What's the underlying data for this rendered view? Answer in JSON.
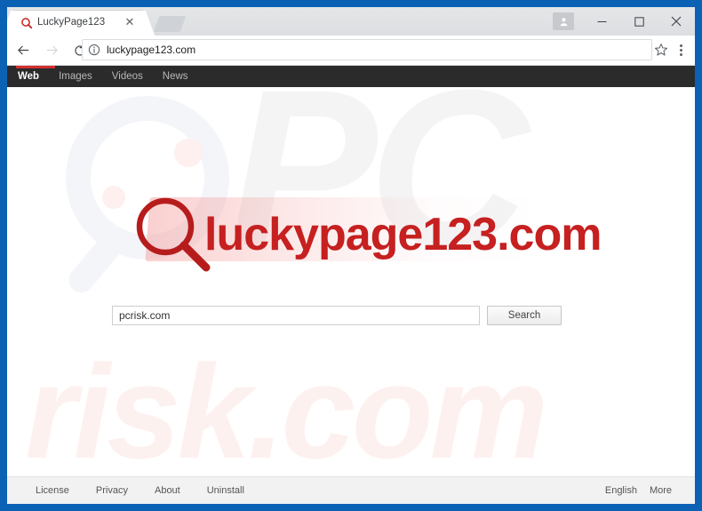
{
  "window": {
    "frame_color": "#0b62b5",
    "controls": {
      "profile_icon": "profile-icon",
      "minimize_label": "─",
      "maximize_label": "□",
      "close_label": "✕"
    }
  },
  "browser": {
    "tab": {
      "title": "LuckyPage123",
      "favicon": "magnifier-icon",
      "close_label": "✕"
    },
    "new_tab_label": "",
    "toolbar": {
      "back_icon": "back-arrow-icon",
      "forward_icon": "forward-arrow-icon",
      "reload_icon": "reload-icon",
      "site_info_icon": "info-circle-icon",
      "url": "luckypage123.com",
      "bookmark_icon": "star-icon",
      "menu_icon": "three-dot-menu-icon"
    }
  },
  "site": {
    "nav": {
      "accent_color": "#d32f2f",
      "items": [
        {
          "label": "Web",
          "active": true
        },
        {
          "label": "Images",
          "active": false
        },
        {
          "label": "Videos",
          "active": false
        },
        {
          "label": "News",
          "active": false
        }
      ]
    },
    "logo": {
      "text": "luckypage123.com",
      "mark": "magnifier-icon",
      "color": "#c62020"
    },
    "search": {
      "value": "pcrisk.com",
      "placeholder": "",
      "button_label": "Search"
    },
    "watermark": {
      "top_text": "PC",
      "bottom_text": "risk.com",
      "glass_icon": "magnifier-watermark-icon"
    },
    "footer": {
      "left_links": [
        "License",
        "Privacy",
        "About",
        "Uninstall"
      ],
      "right_links": [
        "English",
        "More"
      ]
    }
  }
}
